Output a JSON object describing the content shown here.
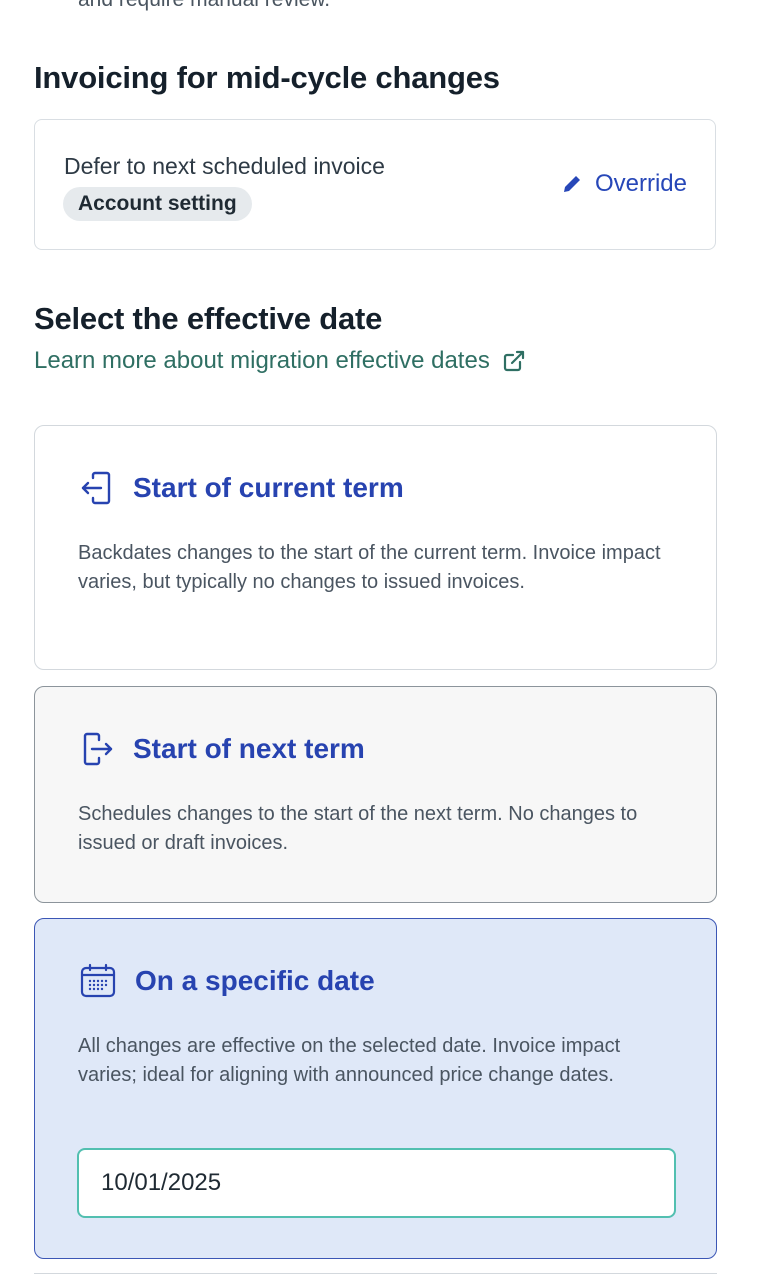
{
  "top_cut_text": "and require manual review.",
  "invoicing": {
    "heading": "Invoicing for mid-cycle changes",
    "value": "Defer to next scheduled invoice",
    "badge": "Account setting",
    "override_label": "Override",
    "override_icon": "pencil-icon"
  },
  "effective_date": {
    "heading": "Select the effective date",
    "learn_more_label": "Learn more about migration effective dates",
    "learn_more_icon": "external-link-icon",
    "options": [
      {
        "icon": "arrow-into-door-icon",
        "title": "Start of current term",
        "description": "Backdates changes to the start of the current term. Invoice impact varies, but typically no changes to issued invoices."
      },
      {
        "icon": "arrow-out-of-door-icon",
        "title": "Start of next term",
        "description": "Schedules changes to the start of the next term. No changes to issued or draft invoices."
      },
      {
        "icon": "calendar-icon",
        "title": "On a specific date",
        "description": "All changes are effective on the selected date. Invoice impact varies; ideal for aligning with announced price change dates.",
        "selected": true,
        "date_value": "10/01/2025"
      }
    ]
  },
  "colors": {
    "accent": "#2743b0",
    "link": "#2f6f63",
    "selected_bg": "#dfe8f8",
    "input_border": "#52bfb0"
  }
}
